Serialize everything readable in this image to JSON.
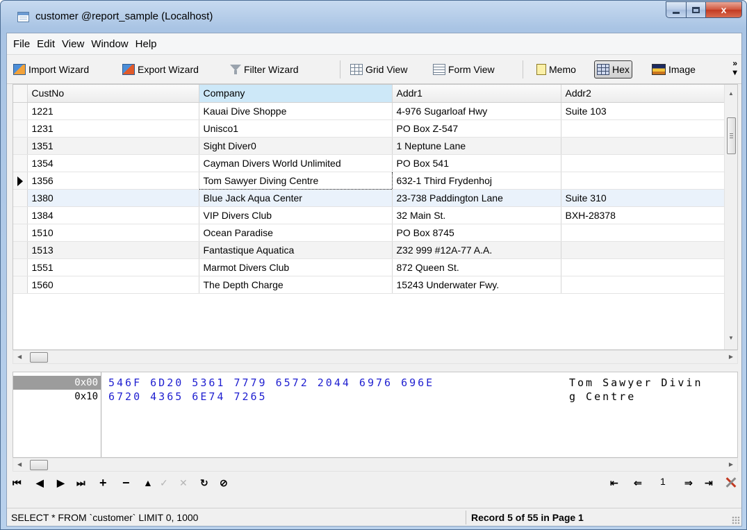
{
  "window": {
    "title": "customer @report_sample (Localhost)",
    "close_glyph": "x"
  },
  "menu": [
    "File",
    "Edit",
    "View",
    "Window",
    "Help"
  ],
  "toolbar": {
    "import_wizard": "Import Wizard",
    "export_wizard": "Export Wizard",
    "filter_wizard": "Filter Wizard",
    "grid_view": "Grid View",
    "form_view": "Form View",
    "memo": "Memo",
    "hex": "Hex",
    "image": "Image",
    "overflow": "»"
  },
  "grid": {
    "columns": [
      "CustNo",
      "Company",
      "Addr1",
      "Addr2"
    ],
    "rows": [
      [
        "1221",
        "Kauai Dive Shoppe",
        "4-976 Sugarloaf Hwy",
        "Suite 103"
      ],
      [
        "1231",
        "Unisco1",
        "PO Box Z-547",
        ""
      ],
      [
        "1351",
        "Sight Diver0",
        "1 Neptune Lane",
        ""
      ],
      [
        "1354",
        "Cayman Divers World Unlimited",
        "PO Box 541",
        ""
      ],
      [
        "1356",
        "Tom Sawyer Diving Centre",
        "632-1 Third Frydenhoj",
        ""
      ],
      [
        "1380",
        "Blue Jack Aqua Center",
        "23-738 Paddington Lane",
        "Suite 310"
      ],
      [
        "1384",
        "VIP Divers Club",
        "32 Main St.",
        "BXH-28378"
      ],
      [
        "1510",
        "Ocean Paradise",
        "PO Box 8745",
        ""
      ],
      [
        "1513",
        "Fantastique Aquatica",
        "Z32 999 #12A-77 A.A.",
        ""
      ],
      [
        "1551",
        "Marmot Divers Club",
        "872 Queen St.",
        ""
      ],
      [
        "1560",
        "The Depth Charge",
        "15243 Underwater Fwy.",
        ""
      ]
    ]
  },
  "hex": {
    "lines": [
      {
        "offset": "0x00",
        "bytes": "546F 6D20 5361 7779 6572 2044 6976 696E",
        "ascii": "Tom Sawyer Divin"
      },
      {
        "offset": "0x10",
        "bytes": "6720 4365 6E74 7265",
        "ascii": "g Centre"
      }
    ]
  },
  "navigator": {
    "first": "⏮",
    "page_number": "1"
  },
  "status": {
    "sql": "SELECT * FROM `customer` LIMIT 0, 1000",
    "record": "Record 5 of 55 in Page 1"
  },
  "colors": {
    "hex_bytes": "#1f1fd0",
    "selected_header": "#cde8f8",
    "close_button": "#c23a22"
  }
}
